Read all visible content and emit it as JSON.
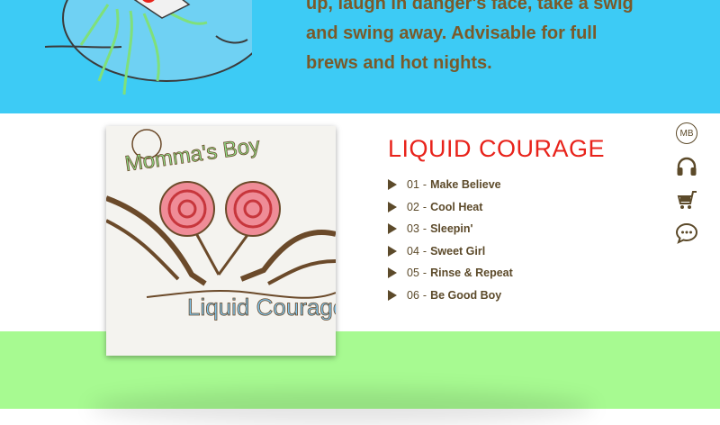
{
  "hero": {
    "lines": [
      "up, laugh in danger's face, take a swig",
      "and swing away. Advisable for full",
      "brews and hot nights."
    ]
  },
  "album": {
    "title": "LIQUID COURAGE",
    "cover_text": {
      "artist": "Momma's Boy",
      "title": "Liquid Courage"
    },
    "tracks": [
      {
        "num": "01",
        "name": "Make Believe"
      },
      {
        "num": "02",
        "name": "Cool Heat"
      },
      {
        "num": "03",
        "name": "Sleepin'"
      },
      {
        "num": "04",
        "name": "Sweet Girl"
      },
      {
        "num": "05",
        "name": "Rinse & Repeat"
      },
      {
        "num": "06",
        "name": "Be Good Boy"
      }
    ]
  },
  "side_nav": {
    "mb_label": "MB",
    "icons": [
      "mb-logo-icon",
      "headphones-icon",
      "cart-icon",
      "chat-bubble-icon"
    ]
  },
  "colors": {
    "top_band": "#3dcbf5",
    "bottom_band": "#a7fa91",
    "title_red": "#e8231b",
    "brown": "#5c4a2a",
    "hero_text": "#7a5a2a"
  }
}
